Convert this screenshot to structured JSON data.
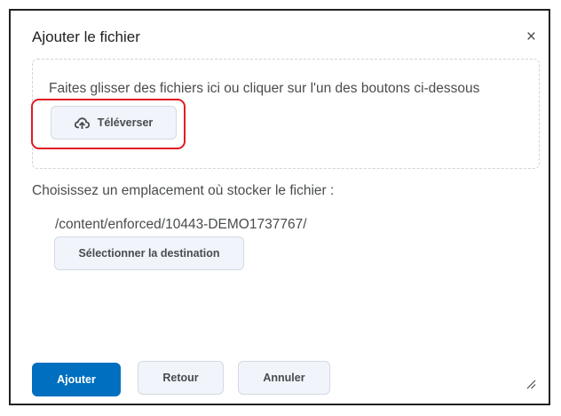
{
  "dialog": {
    "title": "Ajouter le fichier",
    "close_symbol": "×"
  },
  "dropzone": {
    "instructions": "Faites glisser des fichiers ici ou cliquer sur l'un des boutons ci-dessous",
    "upload_label": "Téléverser",
    "upload_icon": "cloud-upload-icon",
    "highlight_color": "#e01b24"
  },
  "storage": {
    "label": "Choisissez un emplacement où stocker le fichier :",
    "path": "/content/enforced/10443-DEMO1737767/",
    "select_destination_label": "Sélectionner la destination"
  },
  "footer": {
    "add_label": "Ajouter",
    "back_label": "Retour",
    "cancel_label": "Annuler",
    "primary_color": "#006fbf"
  }
}
